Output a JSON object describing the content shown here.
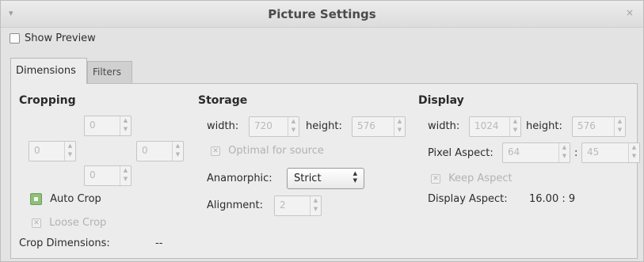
{
  "window": {
    "title": "Picture Settings",
    "menu_glyph": "▾",
    "close_glyph": "×"
  },
  "show_preview": {
    "label": "Show Preview",
    "checked": false
  },
  "tabs": [
    {
      "label": "Dimensions",
      "active": true
    },
    {
      "label": "Filters",
      "active": false
    }
  ],
  "cropping": {
    "title": "Cropping",
    "top": "0",
    "left": "0",
    "right": "0",
    "bottom": "0",
    "auto_crop": {
      "label": "Auto Crop",
      "checked": true
    },
    "loose_crop": {
      "label": "Loose Crop",
      "enabled": false
    },
    "dimensions_label": "Crop Dimensions:",
    "dimensions_value": "--"
  },
  "storage": {
    "title": "Storage",
    "width_label": "width:",
    "width_value": "720",
    "height_label": "height:",
    "height_value": "576",
    "optimal_label": "Optimal for source",
    "anamorphic_label": "Anamorphic:",
    "anamorphic_value": "Strict",
    "alignment_label": "Alignment:",
    "alignment_value": "2"
  },
  "display": {
    "title": "Display",
    "width_label": "width:",
    "width_value": "1024",
    "height_label": "height:",
    "height_value": "576",
    "pixel_aspect_label": "Pixel Aspect:",
    "pixel_aspect_num": "64",
    "pixel_aspect_sep": ":",
    "pixel_aspect_den": "45",
    "keep_aspect_label": "Keep Aspect",
    "display_aspect_label": "Display Aspect:",
    "display_aspect_value": "16.00 : 9"
  },
  "glyphs": {
    "spin_up": "▲",
    "spin_down": "▼",
    "check_x": "✕"
  }
}
